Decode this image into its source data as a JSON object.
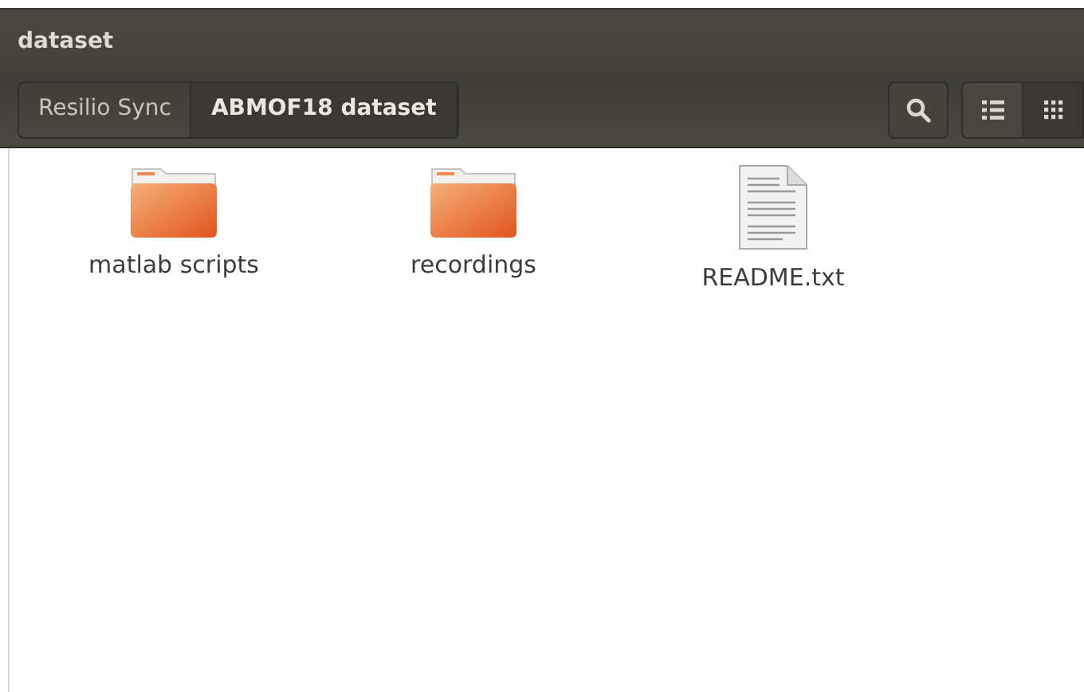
{
  "window": {
    "title": "dataset"
  },
  "breadcrumbs": [
    {
      "label": "Resilio Sync",
      "selected": false
    },
    {
      "label": "ABMOF18 dataset",
      "selected": true
    }
  ],
  "view_buttons": [
    {
      "kind": "list",
      "selected": false
    },
    {
      "kind": "grid",
      "selected": true
    }
  ],
  "files": [
    {
      "name": "matlab scripts",
      "kind": "folder"
    },
    {
      "name": "recordings",
      "kind": "folder"
    },
    {
      "name": "README.txt",
      "kind": "text"
    }
  ]
}
